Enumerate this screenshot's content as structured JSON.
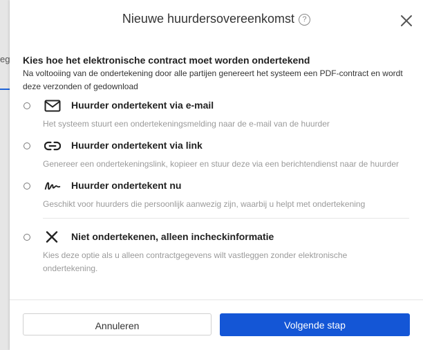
{
  "background": {
    "tab_fragment": "eg"
  },
  "dialog": {
    "title": "Nieuwe huurdersovereenkomst",
    "help_icon": "question-circle-icon",
    "close_icon": "close-icon",
    "heading": "Kies hoe het elektronische contract moet worden ondertekend",
    "subtext": "Na voltooiing van de ondertekening door alle partijen genereert het systeem een PDF-contract en wordt deze verzonden of gedownload",
    "options": [
      {
        "icon": "envelope-icon",
        "title": "Huurder ondertekent via e-mail",
        "description": "Het systeem stuurt een ondertekeningsmelding naar de e-mail van de huurder",
        "selected": false
      },
      {
        "icon": "link-icon",
        "title": "Huurder ondertekent via link",
        "description": "Genereer een ondertekeningslink, kopieer en stuur deze via een berichtendienst naar de huurder",
        "selected": false
      },
      {
        "icon": "signature-icon",
        "title": "Huurder ondertekent nu",
        "description": "Geschikt voor huurders die persoonlijk aanwezig zijn, waarbij u helpt met ondertekening",
        "selected": false
      },
      {
        "icon": "cross-icon",
        "title": "Niet ondertekenen, alleen incheckinformatie",
        "description": "Kies deze optie als u alleen contractgegevens wilt vastleggen zonder elektronische ondertekening.",
        "selected": false
      }
    ],
    "buttons": {
      "cancel": "Annuleren",
      "next": "Volgende stap"
    },
    "colors": {
      "primary": "#1456d6",
      "muted_text": "#9a9a9a"
    }
  }
}
